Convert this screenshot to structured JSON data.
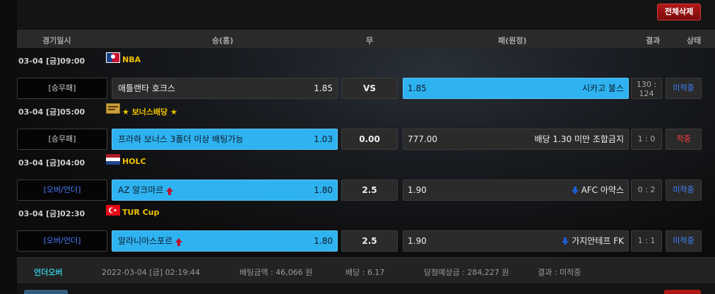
{
  "toolbar": {
    "clear_all_label": "전체삭제"
  },
  "header": {
    "date": "경기일시",
    "win_home": "승(홈)",
    "draw": "무",
    "lose_away": "패(원정)",
    "result": "결과",
    "status": "상태"
  },
  "groups": [
    {
      "datetime": "03-04 [금]09:00",
      "league": "NBA",
      "flag_icon": "nba-logo-icon",
      "bet_type": "[승무패]",
      "home_team": "애틀랜타 호크스",
      "home_odds": "1.85",
      "draw": "VS",
      "away_odds": "1.85",
      "away_team": "시카고 불스",
      "score": "130 : 124",
      "status": "미적중"
    },
    {
      "datetime": "03-04 [금]05:00",
      "league": "★ 보너스배당 ★",
      "flag_icon": "bonus-icon",
      "bet_type": "[승무패]",
      "home_team": "프라하 보너스 3폴더 이상 배팅가능",
      "home_odds": "1.03",
      "draw": "0.00",
      "away_odds": "777.00",
      "away_team": "배당 1.30 미만 조합금지",
      "score": "1 : 0",
      "status": "적중"
    },
    {
      "datetime": "03-04 [금]04:00",
      "league": "HOLC",
      "flag_icon": "netherlands-flag-icon",
      "bet_type": "[오버/언더]",
      "home_team": "AZ 알크마르",
      "home_odds": "1.80",
      "draw": "2.5",
      "away_odds": "1.90",
      "away_team": "AFC 아약스",
      "score": "0 : 2",
      "status": "미적중"
    },
    {
      "datetime": "03-04 [금]02:30",
      "league": "TUR Cup",
      "flag_icon": "turkey-flag-icon",
      "bet_type": "[오버/언더]",
      "home_team": "알라니아스포르",
      "home_odds": "1.80",
      "draw": "2.5",
      "away_odds": "1.90",
      "away_team": "가지안테프 FK",
      "score": "1 : 1",
      "status": "미적중"
    }
  ],
  "summary": {
    "type": "언더오버",
    "datetime": "2022-03-04 [금] 02:19:44",
    "bet_amount": "배팅금액 : 46,066 원",
    "odds": "배당 : 6.17",
    "expected_win": "당첨예상금 : 284,227 원",
    "result": "결과 : 미적중"
  },
  "colors": {
    "selected": "#2fb2f0",
    "league": "#f2c200",
    "lost": "#3d82ff",
    "won": "#ff3c3c",
    "clear_button": "#b01818"
  }
}
